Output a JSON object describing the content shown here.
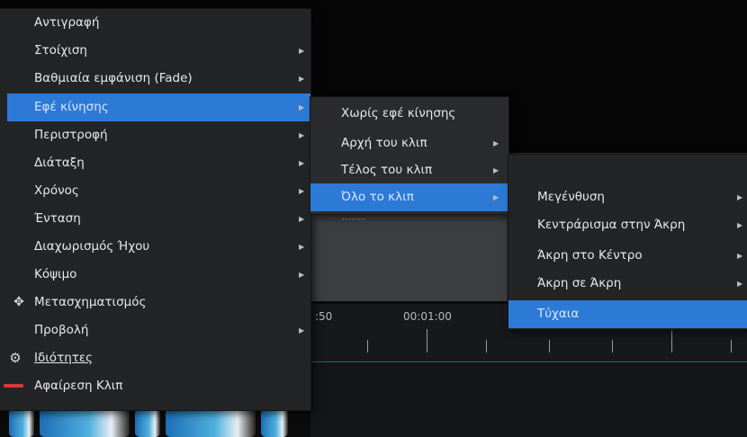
{
  "context_menu": {
    "items": [
      {
        "label": "Αντιγραφή",
        "submenu": false
      },
      {
        "label": "Στοίχιση",
        "submenu": true
      },
      {
        "label": "Βαθμιαία εμφάνιση (Fade)",
        "submenu": true
      },
      {
        "label": "Εφέ κίνησης",
        "submenu": true,
        "highlighted": true
      },
      {
        "label": "Περιστροφή",
        "submenu": true
      },
      {
        "label": "Διάταξη",
        "submenu": true
      },
      {
        "label": "Χρόνος",
        "submenu": true
      },
      {
        "label": "Ένταση",
        "submenu": true
      },
      {
        "label": "Διαχωρισμός Ήχου",
        "submenu": true
      },
      {
        "label": "Κόψιμο",
        "submenu": true
      },
      {
        "label": "Μετασχηματισμός",
        "submenu": false,
        "icon": "move-icon"
      },
      {
        "label": "Προβολή",
        "submenu": true
      },
      {
        "label": "Ιδιότητες",
        "submenu": false,
        "icon": "gear-icon"
      },
      {
        "label": "Αφαίρεση Κλιπ",
        "submenu": false,
        "icon": "remove-icon"
      }
    ]
  },
  "motion_submenu": {
    "items": [
      {
        "label": "Χωρίς εφέ κίνησης",
        "submenu": false
      },
      {
        "label": "Αρχή του κλιπ",
        "submenu": true
      },
      {
        "label": "Τέλος του κλιπ",
        "submenu": true
      },
      {
        "label": "Όλο το κλιπ",
        "submenu": true,
        "highlighted": true
      }
    ]
  },
  "whole_clip_submenu": {
    "items": [
      {
        "label": "Μεγένθυση",
        "submenu": true
      },
      {
        "label": "Κεντράρισμα στην Άκρη",
        "submenu": true
      },
      {
        "label": "Άκρη στο Κέντρο",
        "submenu": true
      },
      {
        "label": "Άκρη σε Άκρη",
        "submenu": true
      },
      {
        "label": "Τύχαια",
        "submenu": false,
        "highlighted": true
      }
    ]
  },
  "timeline": {
    "time_left": ":50",
    "time_mid": "00:01:00"
  },
  "colors": {
    "menu_bg": "#232426",
    "highlight": "#2d7ad6",
    "play_accent": "#c6cf5b",
    "remove_red": "#d23b3b"
  }
}
